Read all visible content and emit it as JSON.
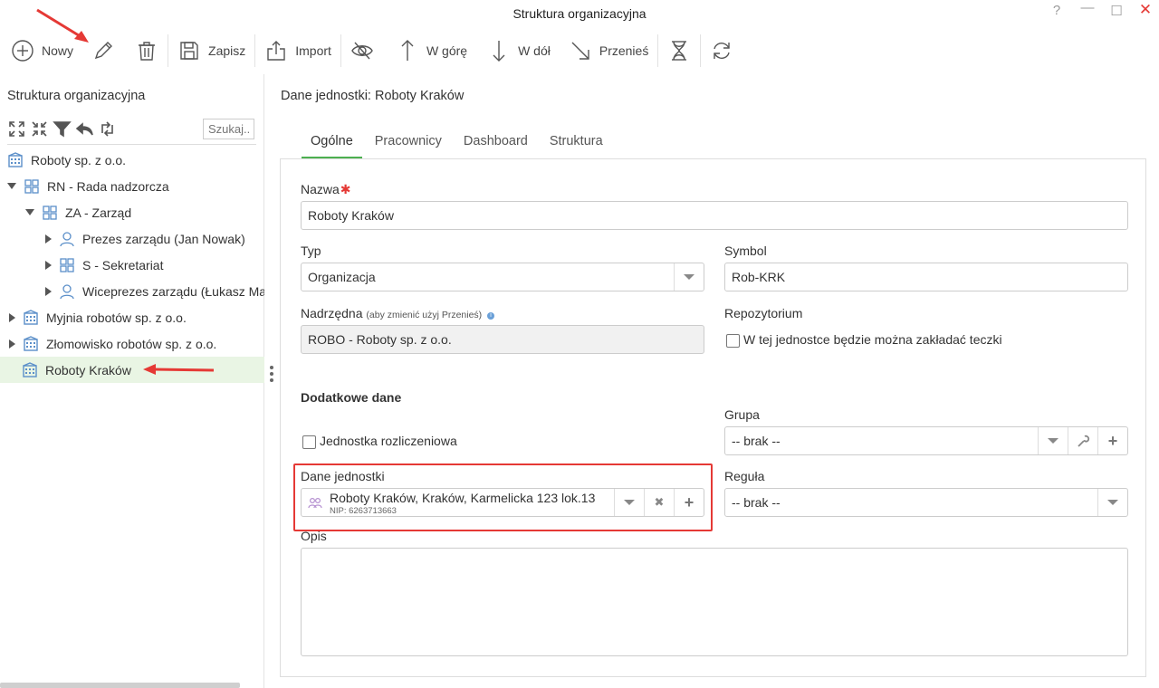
{
  "window": {
    "title": "Struktura organizacyjna",
    "help_glyph": "?",
    "min_glyph": "—",
    "max_glyph": "☐",
    "close_glyph": "✕"
  },
  "toolbar": {
    "new_label": "Nowy",
    "save_label": "Zapisz",
    "import_label": "Import",
    "up_label": "W górę",
    "down_label": "W dół",
    "move_label": "Przenieś"
  },
  "tree": {
    "title": "Struktura organizacyjna",
    "search_placeholder": "Szukaj...",
    "items": [
      {
        "label": "Roboty sp. z o.o."
      },
      {
        "label": "RN - Rada nadzorcza"
      },
      {
        "label": "ZA - Zarząd"
      },
      {
        "label": "Prezes zarządu (Jan Nowak)"
      },
      {
        "label": "S - Sekretariat"
      },
      {
        "label": "Wiceprezes zarządu (Łukasz Ma"
      },
      {
        "label": "Myjnia robotów sp. z o.o."
      },
      {
        "label": "Złomowisko robotów sp. z o.o."
      },
      {
        "label": "Roboty Kraków"
      }
    ]
  },
  "detail": {
    "title": "Dane jednostki: Roboty Kraków",
    "tabs": [
      "Ogólne",
      "Pracownicy",
      "Dashboard",
      "Struktura"
    ],
    "name_label": "Nazwa",
    "required_mark": "✱",
    "name_value": "Roboty Kraków",
    "type_label": "Typ",
    "type_value": "Organizacja",
    "symbol_label": "Symbol",
    "symbol_value": "Rob-KRK",
    "parent_label": "Nadrzędna",
    "parent_hint": "(aby zmienić użyj Przenieś)",
    "info_glyph": "i",
    "parent_value": "ROBO - Roboty sp. z o.o.",
    "repo_label": "Repozytorium",
    "repo_checkbox_label": "W tej jednostce będzie można zakładać teczki",
    "extra_heading": "Dodatkowe dane",
    "group_label": "Grupa",
    "group_value": "-- brak --",
    "billing_checkbox_label": "Jednostka rozliczeniowa",
    "unit_data_label": "Dane jednostki",
    "unit_data_value": "Roboty Kraków, Kraków, Karmelicka 123 lok.13",
    "unit_data_nip": "NIP: 6263713663",
    "rule_label": "Reguła",
    "rule_value": "-- brak --",
    "desc_label": "Opis",
    "clear_glyph": "✖",
    "add_glyph": "+"
  },
  "colors": {
    "accent_green": "#4caf50",
    "selected_row": "#e9f5e4",
    "annotation_red": "#e53935",
    "icon_blue": "#5b8fc9"
  }
}
